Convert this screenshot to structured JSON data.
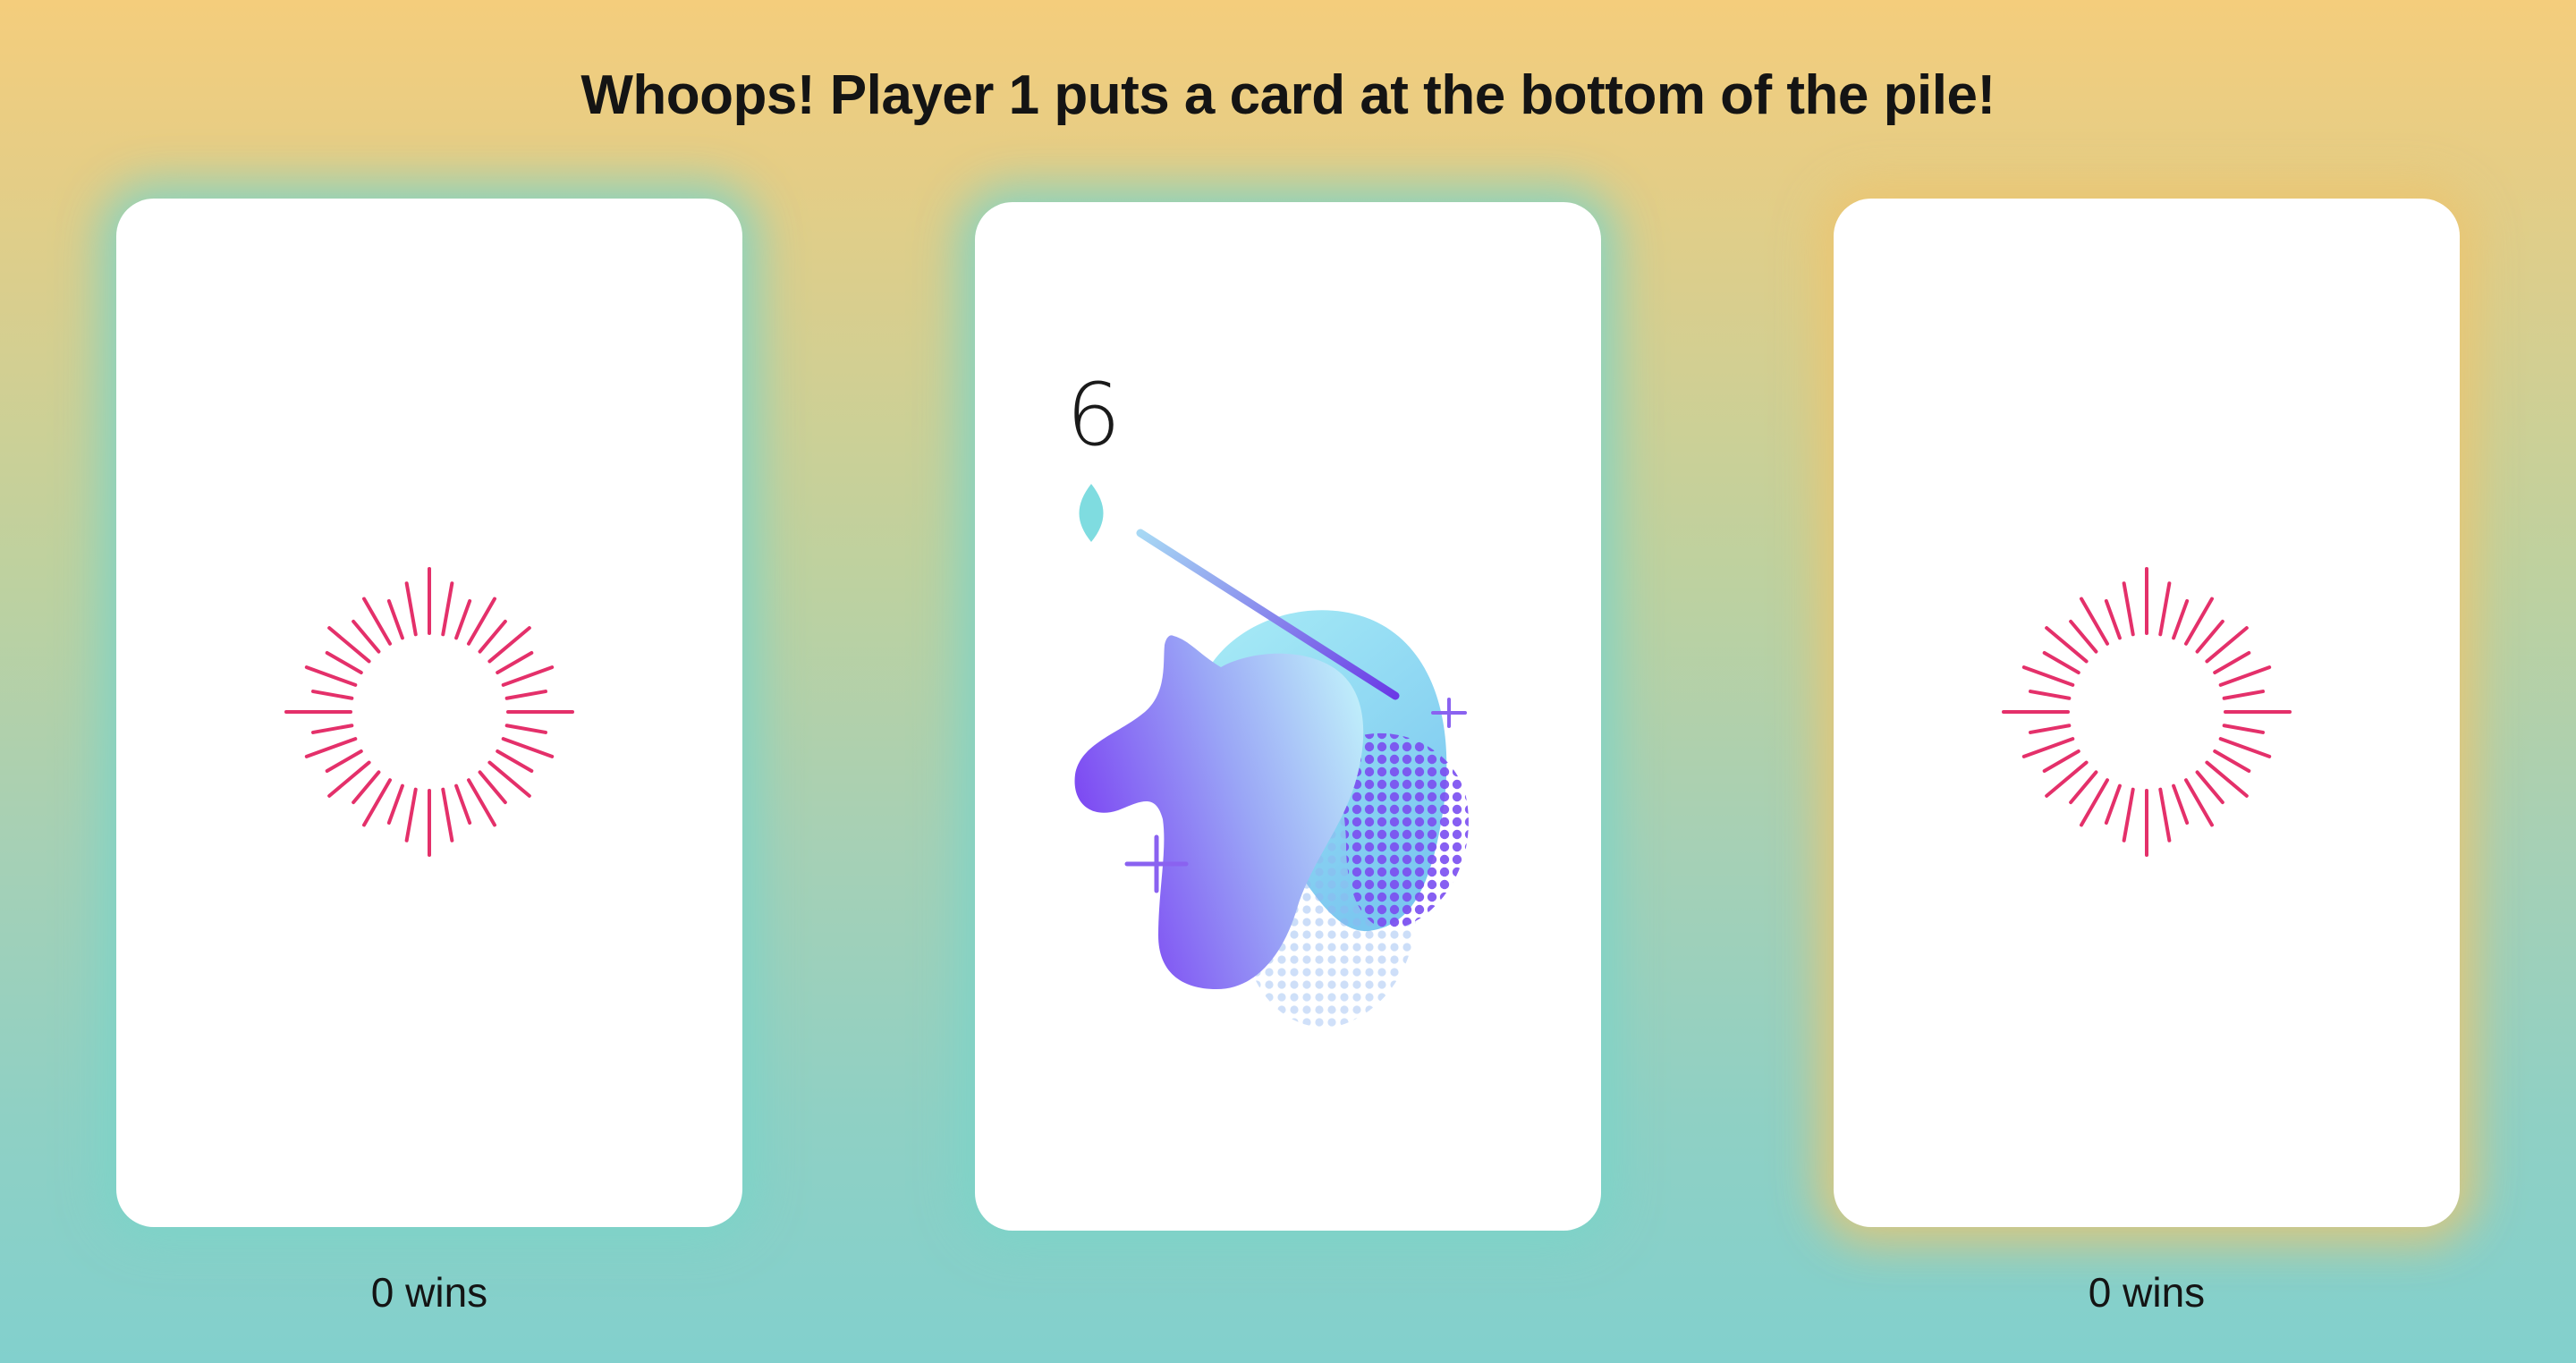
{
  "status_message": "Whoops! Player 1 puts a card at the bottom of the pile!",
  "players": [
    {
      "wins_label": "0 wins",
      "card_state": "face-down",
      "glow_color": "#7ad4c8"
    },
    {
      "wins_label": "0 wins",
      "card_state": "face-down",
      "glow_color": "#ecc46e"
    }
  ],
  "pile_card": {
    "rank": "6",
    "suit_icon": "drop-icon",
    "illustration": "unicorn-head-icon"
  },
  "card_back_icon": "starburst-icon",
  "colors": {
    "background_top": "#f4cd7c",
    "background_bottom": "#82d0cd",
    "starburst": "#e4306a",
    "suit": "#7fdce0",
    "unicorn_purple": "#7a3ff2",
    "unicorn_light": "#a8e8f4"
  }
}
